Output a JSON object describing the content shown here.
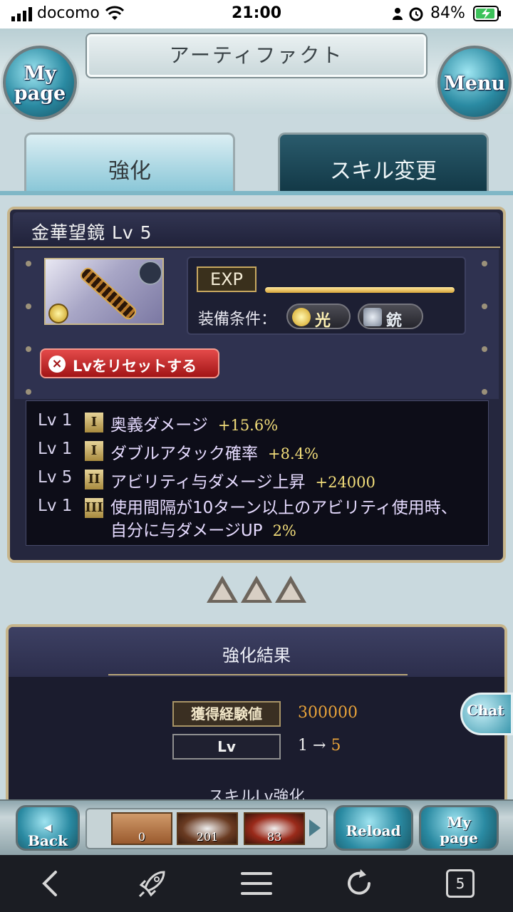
{
  "status_bar": {
    "carrier": "docomo",
    "time": "21:00",
    "battery": "84%"
  },
  "header": {
    "title": "アーティファクト",
    "mypage_label": [
      "My",
      "page"
    ],
    "menu_label": "Menu"
  },
  "tabs": [
    {
      "label": "強化",
      "active": true
    },
    {
      "label": "スキル変更",
      "active": false
    }
  ],
  "artifact": {
    "name": "金華望鏡 Lv 5",
    "exp_label": "EXP",
    "exp_fill": 1.0,
    "equip_label": "装備条件：",
    "element": "光",
    "weapon": "銃",
    "reset_label": "Lvをリセットする",
    "skills": [
      {
        "lv": "Lv 1",
        "rank": "I",
        "name": "奥義ダメージ",
        "value": "+15.6%"
      },
      {
        "lv": "Lv 1",
        "rank": "I",
        "name": "ダブルアタック確率",
        "value": "+8.4%"
      },
      {
        "lv": "Lv 5",
        "rank": "II",
        "name": "アビリティ与ダメージ上昇",
        "value": "+24000"
      },
      {
        "lv": "Lv 1",
        "rank": "III",
        "name": "使用間隔が10ターン以上のアビリティ使用時、自分に与ダメージUP",
        "value": "2%"
      }
    ]
  },
  "result": {
    "title": "強化結果",
    "exp_label": "獲得経験値",
    "exp_value": "300000",
    "lv_label": "Lv",
    "lv_from": "1 →",
    "lv_to": "5",
    "subheading": "スキルLv強化"
  },
  "chat_label": "Chat",
  "bottom_bar": {
    "back_label": [
      "◀",
      "Back"
    ],
    "reload_label": "Reload",
    "mypage_label": [
      "My",
      "page"
    ],
    "items": [
      "0",
      "201",
      "83"
    ]
  },
  "browser": {
    "tab_count": "5"
  },
  "colors": {
    "accent_gold": "#c7b58b",
    "exp_value": "#e8a33a",
    "skill_value": "#f2dd7a",
    "reset_red": "#c22a2a"
  },
  "icons": [
    "signal-icon",
    "wifi-icon",
    "alarm-icon",
    "battery-charging-icon",
    "back-arrow-icon",
    "rocket-icon",
    "hamburger-menu-icon",
    "reload-icon",
    "tabs-icon"
  ]
}
